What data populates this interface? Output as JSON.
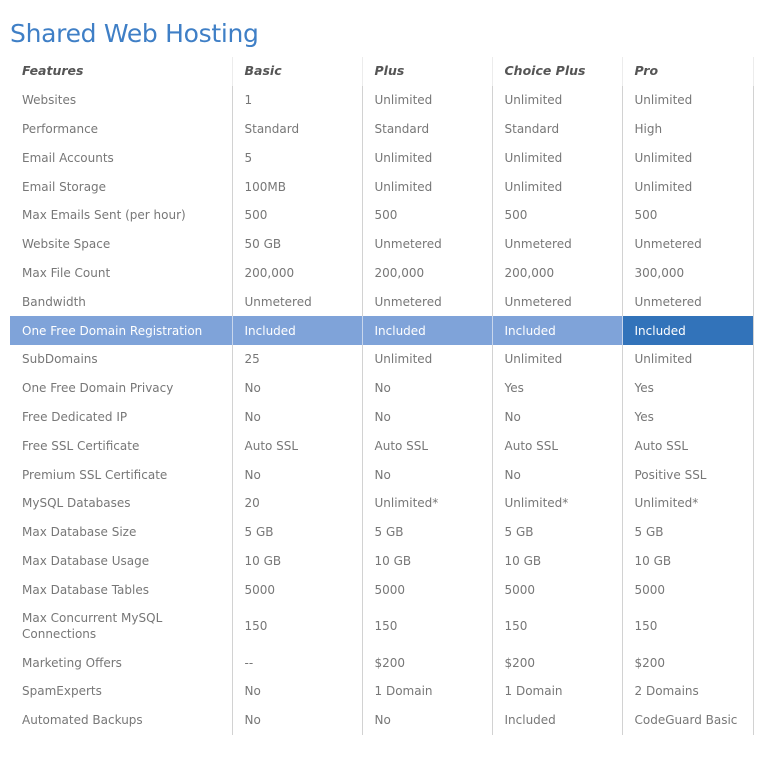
{
  "page": {
    "title": "Shared Web Hosting"
  },
  "table": {
    "headers": [
      "Features",
      "Basic",
      "Plus",
      "Choice Plus",
      "Pro"
    ],
    "highlight_colors": {
      "row": "#7fa3d9",
      "pro_cell": "#3273ba"
    },
    "rows": [
      {
        "feature": "Websites",
        "values": [
          "1",
          "Unlimited",
          "Unlimited",
          "Unlimited"
        ]
      },
      {
        "feature": "Performance",
        "values": [
          "Standard",
          "Standard",
          "Standard",
          "High"
        ]
      },
      {
        "feature": "Email Accounts",
        "values": [
          "5",
          "Unlimited",
          "Unlimited",
          "Unlimited"
        ]
      },
      {
        "feature": "Email Storage",
        "values": [
          "100MB",
          "Unlimited",
          "Unlimited",
          "Unlimited"
        ]
      },
      {
        "feature": "Max Emails Sent (per hour)",
        "values": [
          "500",
          "500",
          "500",
          "500"
        ]
      },
      {
        "feature": "Website Space",
        "values": [
          "50 GB",
          "Unmetered",
          "Unmetered",
          "Unmetered"
        ]
      },
      {
        "feature": "Max File Count",
        "values": [
          "200,000",
          "200,000",
          "200,000",
          "300,000"
        ]
      },
      {
        "feature": "Bandwidth",
        "values": [
          "Unmetered",
          "Unmetered",
          "Unmetered",
          "Unmetered"
        ]
      },
      {
        "feature": "One Free Domain Registration",
        "values": [
          "Included",
          "Included",
          "Included",
          "Included"
        ],
        "highlighted": true
      },
      {
        "feature": "SubDomains",
        "values": [
          "25",
          "Unlimited",
          "Unlimited",
          "Unlimited"
        ]
      },
      {
        "feature": "One Free Domain Privacy",
        "values": [
          "No",
          "No",
          "Yes",
          "Yes"
        ]
      },
      {
        "feature": "Free Dedicated IP",
        "values": [
          "No",
          "No",
          "No",
          "Yes"
        ]
      },
      {
        "feature": "Free SSL Certificate",
        "values": [
          "Auto SSL",
          "Auto SSL",
          "Auto SSL",
          "Auto SSL"
        ]
      },
      {
        "feature": "Premium SSL Certificate",
        "values": [
          "No",
          "No",
          "No",
          "Positive SSL"
        ]
      },
      {
        "feature": "MySQL Databases",
        "values": [
          "20",
          "Unlimited*",
          "Unlimited*",
          "Unlimited*"
        ]
      },
      {
        "feature": "Max Database Size",
        "values": [
          "5 GB",
          "5 GB",
          "5 GB",
          "5 GB"
        ]
      },
      {
        "feature": "Max Database Usage",
        "values": [
          "10 GB",
          "10 GB",
          "10 GB",
          "10 GB"
        ]
      },
      {
        "feature": "Max Database Tables",
        "values": [
          "5000",
          "5000",
          "5000",
          "5000"
        ]
      },
      {
        "feature": "Max Concurrent MySQL Connections",
        "values": [
          "150",
          "150",
          "150",
          "150"
        ]
      },
      {
        "feature": "Marketing Offers",
        "values": [
          "--",
          "$200",
          "$200",
          "$200"
        ]
      },
      {
        "feature": "SpamExperts",
        "values": [
          "No",
          "1 Domain",
          "1 Domain",
          "2 Domains"
        ]
      },
      {
        "feature": "Automated Backups",
        "values": [
          "No",
          "No",
          "Included",
          "CodeGuard Basic"
        ]
      }
    ]
  }
}
